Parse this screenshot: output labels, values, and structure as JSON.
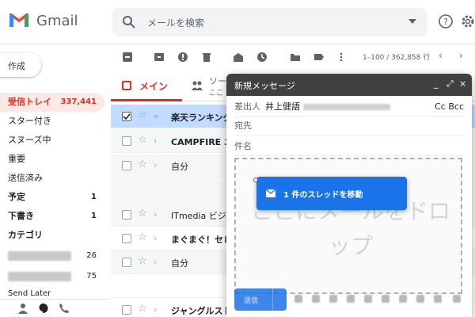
{
  "header": {
    "app_name": "Gmail",
    "search_placeholder": "メールを検索"
  },
  "sidebar": {
    "compose_label": "作成",
    "items": [
      {
        "label": "受信トレイ",
        "count": "337,441"
      },
      {
        "label": "スター付き",
        "count": ""
      },
      {
        "label": "スヌーズ中",
        "count": ""
      },
      {
        "label": "重要",
        "count": ""
      },
      {
        "label": "送信済み",
        "count": ""
      },
      {
        "label": "予定",
        "count": "1"
      },
      {
        "label": "下書き",
        "count": "1"
      },
      {
        "label": "カテゴリ",
        "count": ""
      },
      {
        "label": "",
        "count": "26"
      },
      {
        "label": "",
        "count": "75"
      },
      {
        "label": "Send Later",
        "count": ""
      }
    ]
  },
  "toolbar": {
    "pager_text": "1–100 / 362,858 行"
  },
  "tabs": {
    "main_label": "メイン",
    "social_label": "ソーシャル",
    "social_sub": "ここ"
  },
  "mail_rows": [
    {
      "sender": "楽天ランキング",
      "important": true,
      "yellow": false,
      "bold": true
    },
    {
      "sender": "CAMPFIRE ニュース",
      "important": true,
      "yellow": false,
      "bold": true
    },
    {
      "sender": "自分",
      "important": true,
      "yellow": true,
      "bold": false
    },
    {
      "sender": "ITmedia ビジネス",
      "important": true,
      "yellow": false,
      "bold": false
    },
    {
      "sender": "まぐまぐ！セレクト",
      "important": true,
      "yellow": false,
      "bold": true
    },
    {
      "sender": "自分",
      "important": true,
      "yellow": true,
      "bold": false
    },
    {
      "sender": "ジャングルストア",
      "important": true,
      "yellow": false,
      "bold": true
    }
  ],
  "compose_window": {
    "title": "新規メッセージ",
    "from_label": "差出人",
    "from_value": "井上健語",
    "cc_bcc": "Cc Bcc",
    "to_label": "宛先",
    "subject_label": "件名",
    "drop_text": "ここにメールをドロップ",
    "send_label": "送信"
  },
  "drag_chip": {
    "label": "1 件のスレッドを移動"
  },
  "colors": {
    "accent_red": "#d93025",
    "selected_row": "#c2dbff",
    "drag_blue": "#1a73e8",
    "compose_header": "#404040"
  }
}
